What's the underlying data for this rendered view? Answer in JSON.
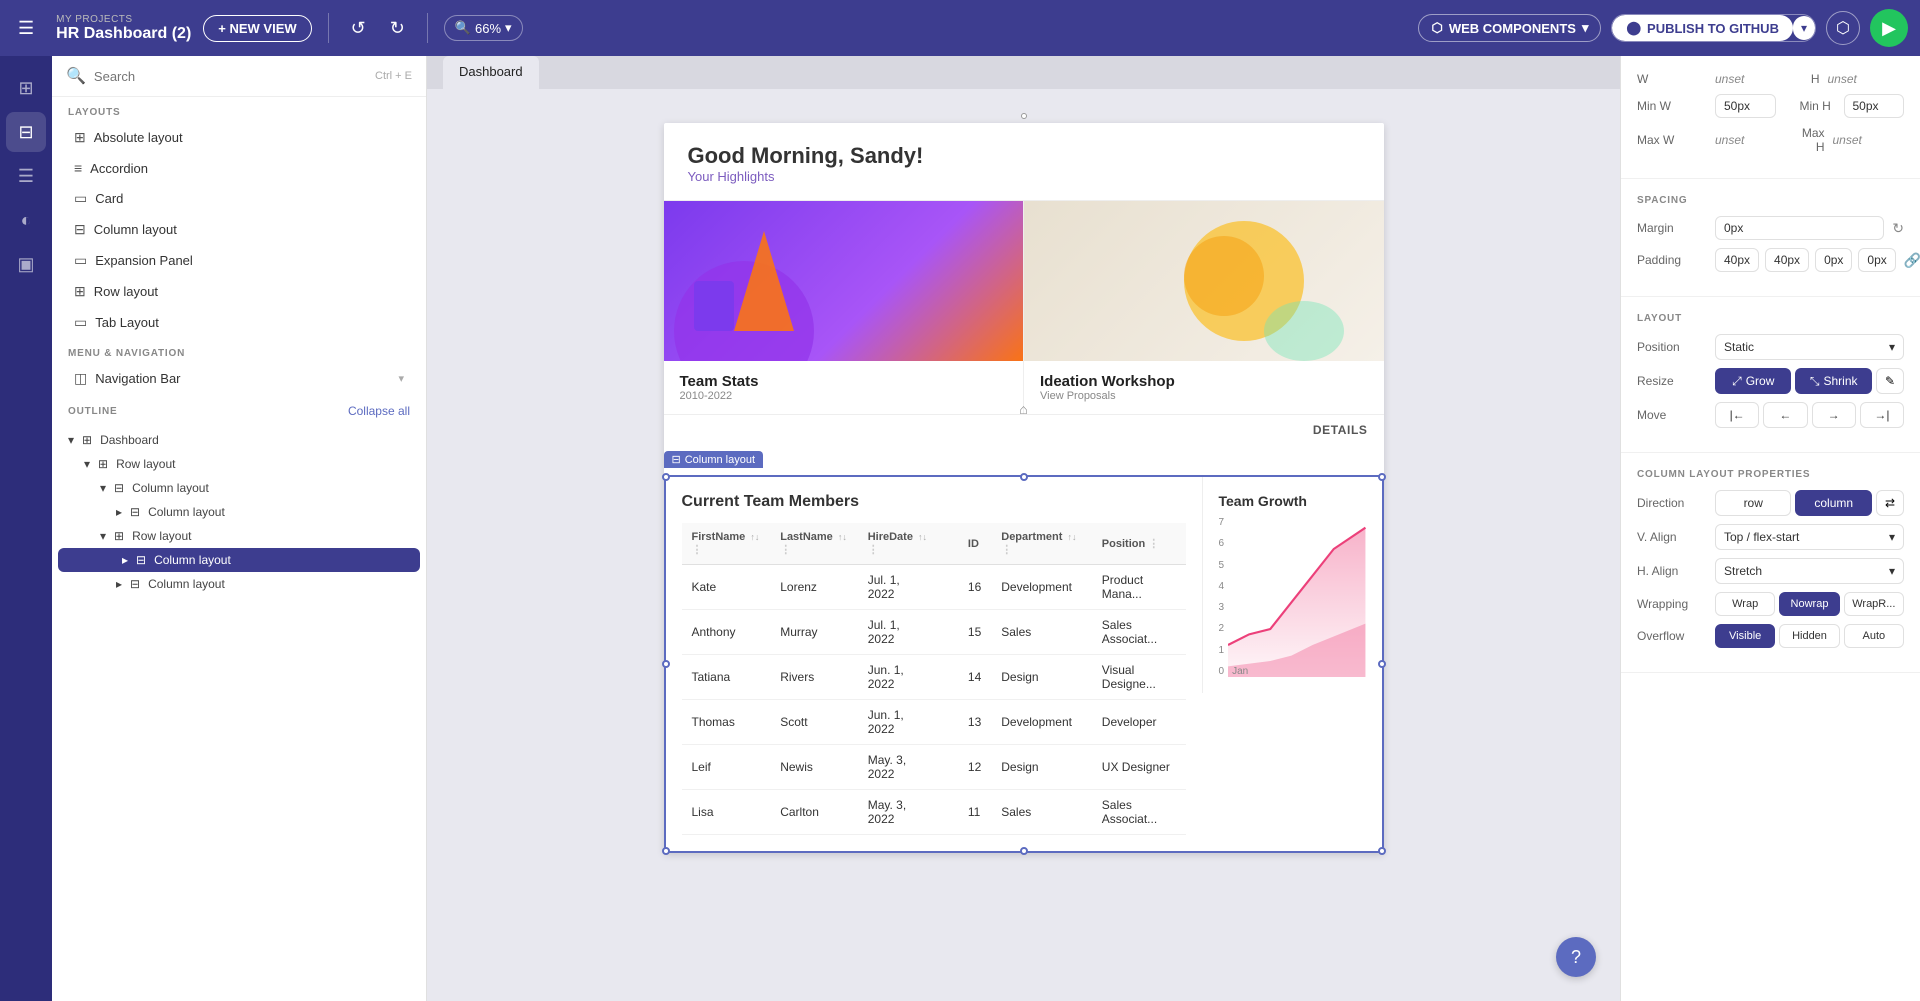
{
  "topbar": {
    "project_label": "MY PROJECTS",
    "project_title": "HR Dashboard (2)",
    "new_view_label": "+ NEW VIEW",
    "zoom_label": "66%",
    "web_components_label": "WEB COMPONENTS",
    "publish_label": "PUBLISH TO GITHUB"
  },
  "sidebar": {
    "search_placeholder": "Search",
    "search_shortcut": "Ctrl + E",
    "sections": {
      "layouts_label": "LAYOUTS",
      "menu_nav_label": "MENU & NAVIGATION",
      "outline_label": "OUTLINE"
    },
    "layouts": [
      {
        "label": "Absolute layout",
        "icon": "⊞"
      },
      {
        "label": "Accordion",
        "icon": "≡"
      },
      {
        "label": "Card",
        "icon": "▭"
      },
      {
        "label": "Column layout",
        "icon": "⊟"
      },
      {
        "label": "Expansion Panel",
        "icon": "▭"
      },
      {
        "label": "Row layout",
        "icon": "⊞"
      },
      {
        "label": "Tab Layout",
        "icon": "▭"
      }
    ],
    "menu_nav": [
      {
        "label": "Navigation Bar",
        "icon": "◫"
      }
    ],
    "collapse_all_label": "Collapse all",
    "outline": [
      {
        "label": "Dashboard",
        "level": 0,
        "expanded": true,
        "icon": "⊞"
      },
      {
        "label": "Row layout",
        "level": 1,
        "expanded": true,
        "icon": "⊞"
      },
      {
        "label": "Column layout",
        "level": 2,
        "expanded": true,
        "icon": "⊟"
      },
      {
        "label": "Column layout",
        "level": 3,
        "expanded": false,
        "icon": "⊟"
      },
      {
        "label": "Row layout",
        "level": 2,
        "expanded": false,
        "icon": "⊞"
      },
      {
        "label": "Column layout",
        "level": 3,
        "expanded": false,
        "icon": "⊟",
        "active": true
      },
      {
        "label": "Column layout",
        "level": 3,
        "expanded": false,
        "icon": "⊟"
      }
    ]
  },
  "canvas": {
    "tab_label": "Dashboard",
    "greeting": "Good Morning, Sandy!",
    "greeting_sub": "Your Highlights",
    "selected_label": "Column layout",
    "cards": [
      {
        "title": "Team Stats",
        "subtitle": "2010-2022"
      },
      {
        "title": "Ideation Workshop",
        "subtitle": "View Proposals"
      }
    ],
    "details_btn": "DETAILS",
    "team_table": {
      "title": "Current Team Members",
      "columns": [
        "FirstName",
        "LastName",
        "HireDate",
        "",
        "ID",
        "Department",
        "Position"
      ],
      "rows": [
        [
          "Kate",
          "Lorenz",
          "Jul. 1, 2022",
          "",
          "16",
          "Development",
          "Product Mana..."
        ],
        [
          "Anthony",
          "Murray",
          "Jul. 1, 2022",
          "",
          "15",
          "Sales",
          "Sales Associat..."
        ],
        [
          "Tatiana",
          "Rivers",
          "Jun. 1, 2022",
          "",
          "14",
          "Design",
          "Visual Designe..."
        ],
        [
          "Thomas",
          "Scott",
          "Jun. 1, 2022",
          "",
          "13",
          "Development",
          "Developer"
        ],
        [
          "Leif",
          "Newis",
          "May. 3, 2022",
          "",
          "12",
          "Design",
          "UX Designer"
        ],
        [
          "Lisa",
          "Carlton",
          "May. 3, 2022",
          "",
          "11",
          "Sales",
          "Sales Associat..."
        ]
      ]
    },
    "growth_title": "Team Growth",
    "growth_labels": [
      "7",
      "6",
      "5",
      "4",
      "3",
      "2",
      "1",
      "0"
    ],
    "growth_x": "Jan"
  },
  "right_panel": {
    "dimensions": {
      "w_label": "W",
      "w_value": "unset",
      "h_label": "H",
      "h_value": "unset",
      "min_w_label": "Min W",
      "min_w_value": "50px",
      "min_h_label": "Min H",
      "min_h_value": "50px",
      "max_w_label": "Max W",
      "max_w_value": "unset",
      "max_h_label": "Max H",
      "max_h_value": "unset"
    },
    "spacing": {
      "title": "SPACING",
      "margin_label": "Margin",
      "margin_value": "0px",
      "padding_label": "Padding",
      "padding_values": [
        "40px",
        "40px",
        "0px",
        "0px"
      ]
    },
    "layout": {
      "title": "LAYOUT",
      "position_label": "Position",
      "position_value": "Static",
      "resize_label": "Resize",
      "grow_label": "Grow",
      "shrink_label": "Shrink",
      "move_label": "Move"
    },
    "column_layout": {
      "title": "COLUMN LAYOUT PROPERTIES",
      "direction_label": "Direction",
      "row_label": "row",
      "column_label": "column",
      "valign_label": "V. Align",
      "valign_value": "Top / flex-start",
      "halign_label": "H. Align",
      "halign_value": "Stretch",
      "wrapping_label": "Wrapping",
      "wrap_label": "Wrap",
      "nowrap_label": "Nowrap",
      "wrapr_label": "WrapR...",
      "overflow_label": "Overflow",
      "visible_label": "Visible",
      "hidden_label": "Hidden",
      "auto_label": "Auto"
    }
  },
  "help_label": "?"
}
